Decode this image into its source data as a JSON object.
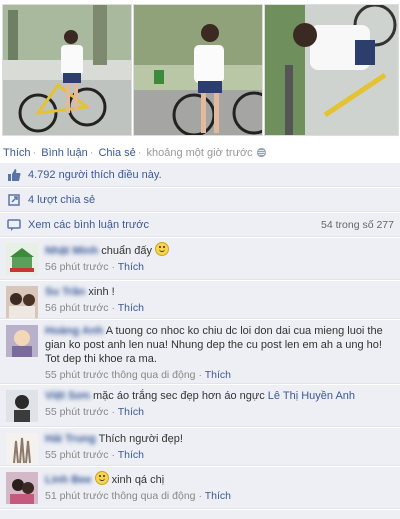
{
  "actions": {
    "like": "Thích",
    "comment": "Bình luận",
    "share": "Chia sẻ",
    "time": "khoảng một giờ trước"
  },
  "likes_text": "4.792 người thích điều này.",
  "shares_text": "4 lượt chia sẻ",
  "view_comments": "Xem các bình luận trước",
  "comment_count": "54 trong số 277",
  "comments": [
    {
      "author": "Nhật Minh",
      "text": "chuẩn đấy",
      "time": "56 phút trước",
      "like": "Thích"
    },
    {
      "author": "Su Trần",
      "text": "xinh !",
      "time": "56 phút trước",
      "like": "Thích"
    },
    {
      "author": "Hoàng Anh",
      "text": "A tuong co nhoc ko chiu dc loi don dai cua mieng luoi the gian ko post anh len nua! Nhung dep the cu post len em ah a ung ho! Tot dep thi khoe ra ma.",
      "time": "55 phút trước thông qua di động",
      "like": "Thích"
    },
    {
      "author": "Việt Sơn",
      "text": "mặc áo trắng sec đẹp hơn áo ngực",
      "mention": "Lê Thị Huyền Anh",
      "time": "55 phút trước",
      "like": "Thích"
    },
    {
      "author": "Hải Trung",
      "text": "Thích người đẹp!",
      "time": "55 phút trước",
      "like": "Thích"
    },
    {
      "author": "Linh Bee",
      "text": "xinh qá chị",
      "time": "51 phút trước thông qua di động",
      "like": "Thích"
    }
  ],
  "icons": {
    "like": "thumbs-up-icon",
    "share": "share-icon",
    "comments": "comment-icon",
    "globe": "globe-icon"
  }
}
